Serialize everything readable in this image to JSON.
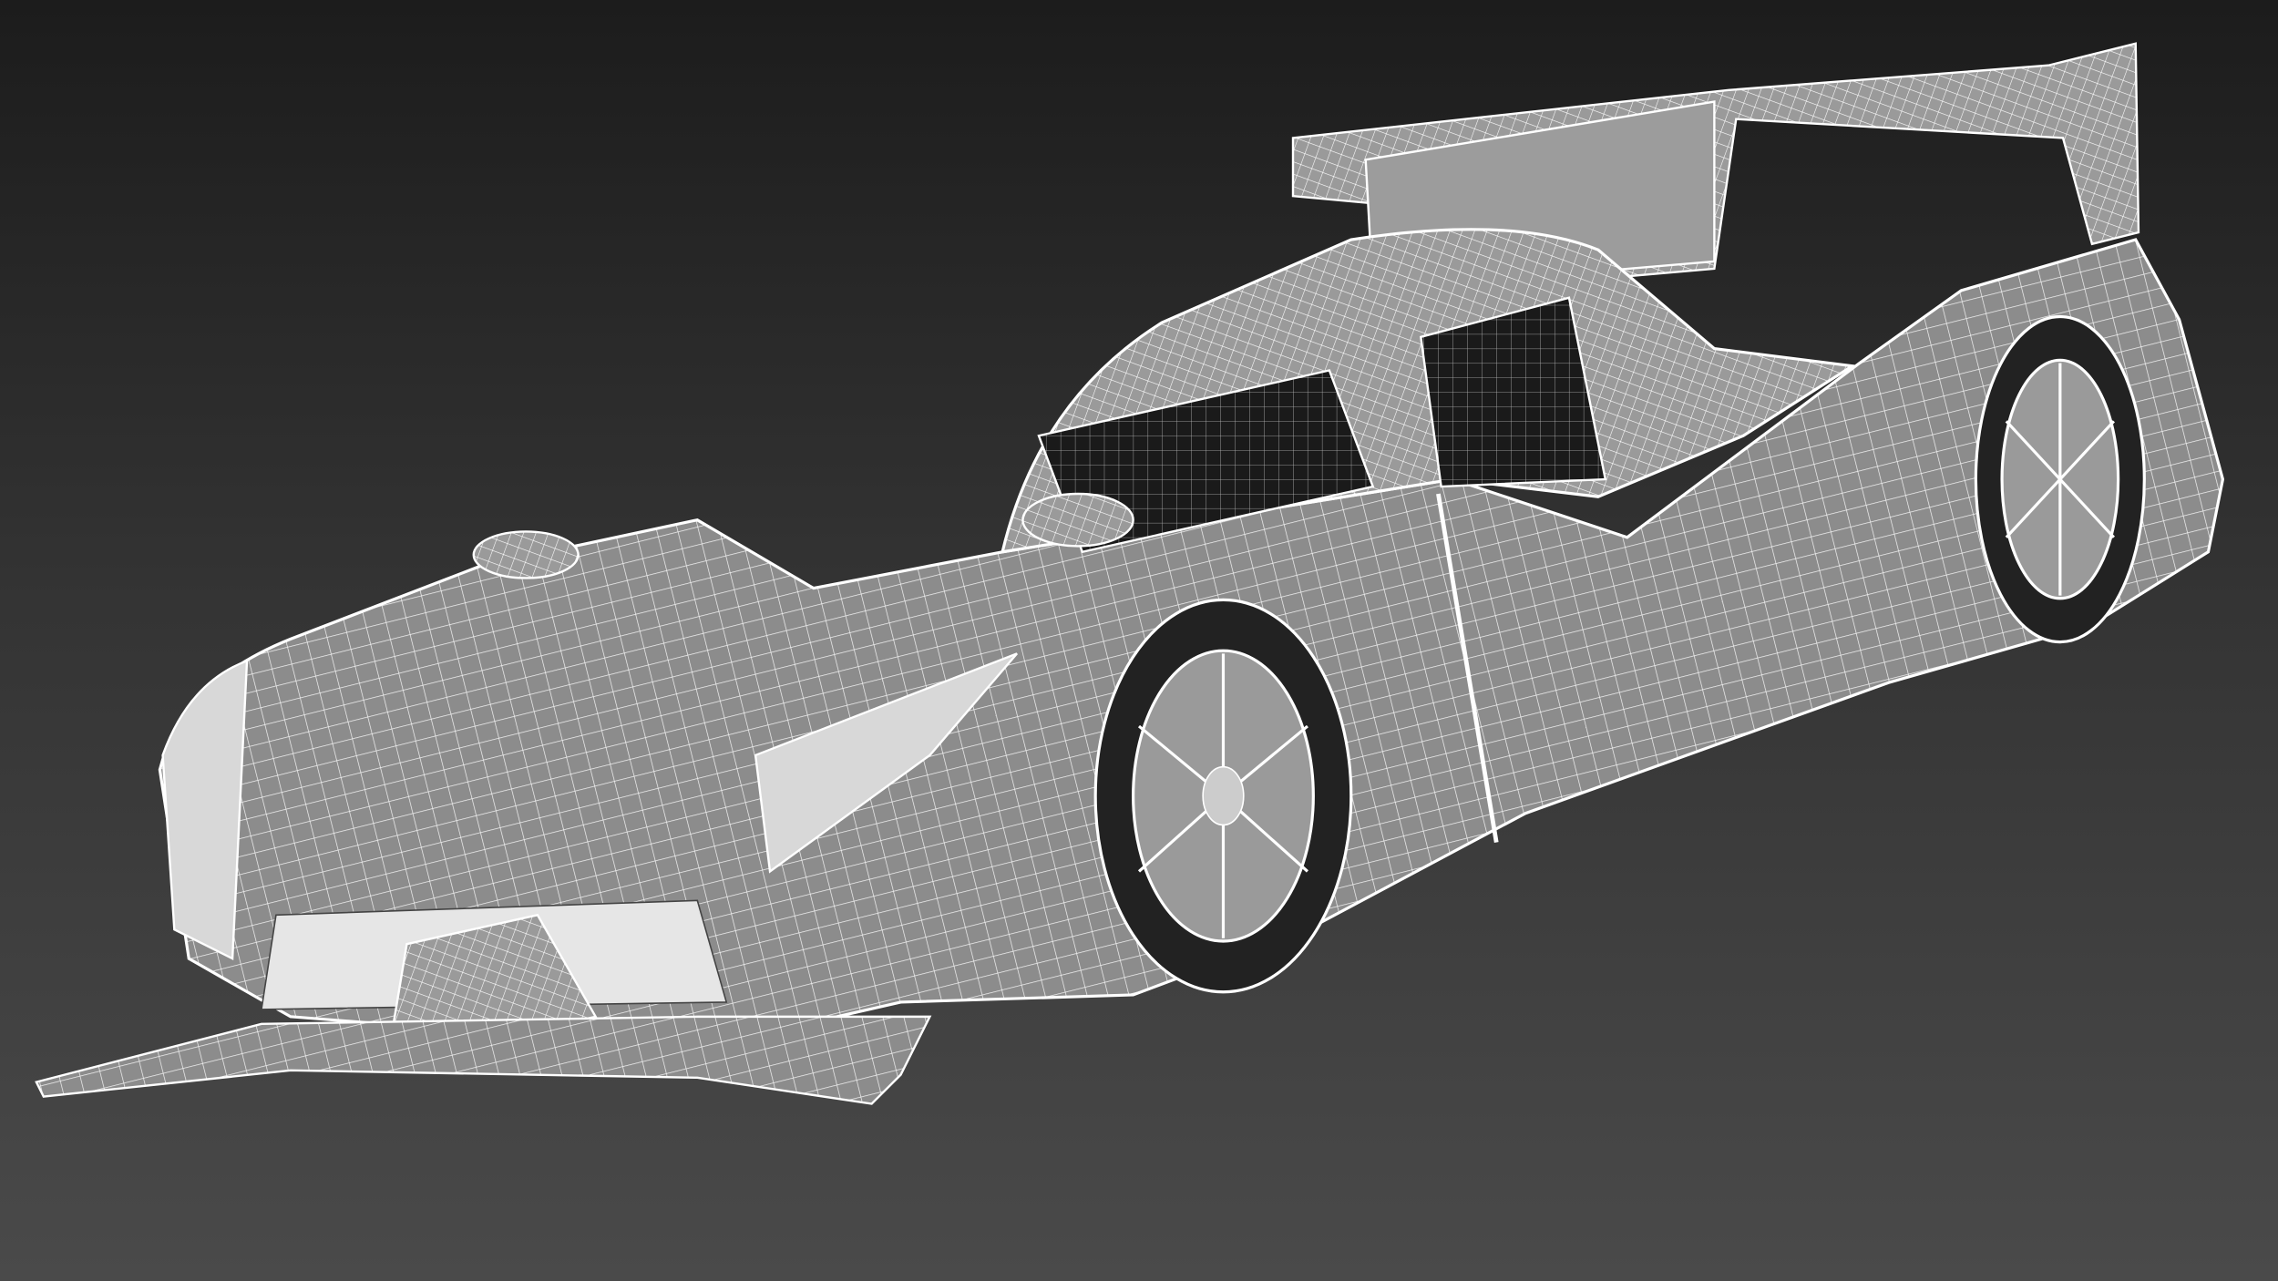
{
  "scene": {
    "background_top": "#1c1c1c",
    "background_bottom": "#4a4a4a",
    "wire_color": "#ffffff",
    "surface_color": "#8c8c8c",
    "glass_color": "#1a1a1a",
    "tire_color": "#222222"
  }
}
